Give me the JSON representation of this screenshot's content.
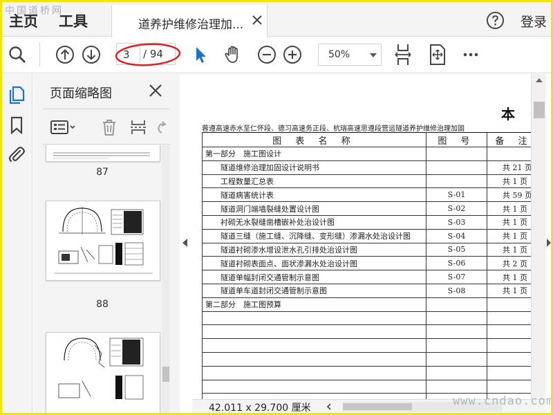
{
  "watermark_top": "中国道桥网",
  "watermark_bottom": "www.cndao.com",
  "tabs": {
    "home": "主页",
    "tools": "工具",
    "document": "道养护维修治理加..."
  },
  "header": {
    "login": "登录"
  },
  "toolbar": {
    "page_current": "3",
    "page_total": "/ 94",
    "zoom": "50%"
  },
  "thumbnail_panel": {
    "title": "页面缩略图",
    "thumbnails": [
      {
        "page": "87"
      },
      {
        "page": "88"
      }
    ]
  },
  "document": {
    "big_char": "本",
    "subtitle": "蓉遵高速赤水至仁怀段、德习高速务正段、杭瑞高速思遵段营运隧道养护维修治理加固",
    "table": {
      "headers": [
        "图 表 名 称",
        "图 号",
        "备 注"
      ],
      "rows": [
        {
          "item": "第一部分　施工图设计",
          "code": "",
          "note": "",
          "section": true
        },
        {
          "item": "隧道维修治理加固设计说明书",
          "code": "",
          "note": "共 21 页"
        },
        {
          "item": "工程数量汇总表",
          "code": "",
          "note": "共 1 页"
        },
        {
          "item": "隧道病害统计表",
          "code": "S-01",
          "note": "共 59 页"
        },
        {
          "item": "隧道洞门端墙裂缝处置设计图",
          "code": "S-02",
          "note": "共 1 页"
        },
        {
          "item": "衬砌无水裂缝凿槽嵌补处治设计图",
          "code": "S-03",
          "note": "共 1 页"
        },
        {
          "item": "隧道三缝（施工缝、沉降缝、变形缝）渗漏水处治设计图",
          "code": "S-04",
          "note": "共 1 页"
        },
        {
          "item": "隧道衬砌渗水增设泄水孔引排处治设计图",
          "code": "S-05",
          "note": "共 1 页"
        },
        {
          "item": "隧道衬砌表面点、面状渗漏水处治设计图",
          "code": "S-06",
          "note": "共 2 页"
        },
        {
          "item": "隧道单幅封闭交通管制示意图",
          "code": "S-07",
          "note": "共 1 页"
        },
        {
          "item": "隧道单车道封闭交通管制示意图",
          "code": "S-08",
          "note": "共 1 页"
        },
        {
          "item": "第二部分　施工图预算",
          "code": "",
          "note": "",
          "section": true
        }
      ],
      "empty_rows": 8
    }
  },
  "status": {
    "page_size": "42.011 x 29.700 厘米"
  },
  "colors": {
    "accent_blue": "#1a73c9",
    "annotation_red": "#e02020",
    "frame_yellow": "#f0e600"
  }
}
